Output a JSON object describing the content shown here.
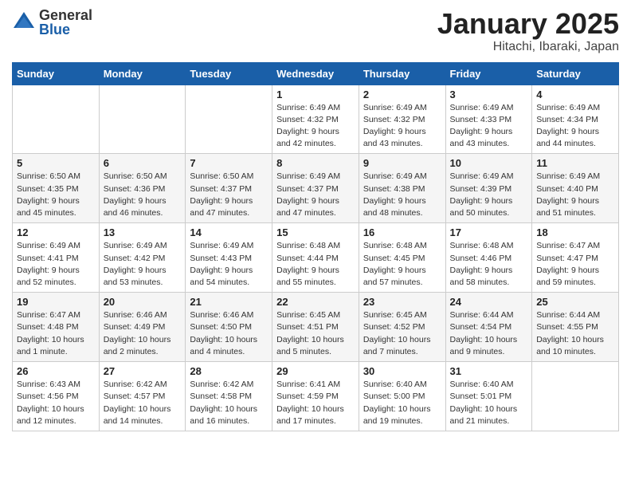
{
  "logo": {
    "general": "General",
    "blue": "Blue"
  },
  "title": "January 2025",
  "subtitle": "Hitachi, Ibaraki, Japan",
  "weekdays": [
    "Sunday",
    "Monday",
    "Tuesday",
    "Wednesday",
    "Thursday",
    "Friday",
    "Saturday"
  ],
  "weeks": [
    [
      {
        "day": "",
        "info": ""
      },
      {
        "day": "",
        "info": ""
      },
      {
        "day": "",
        "info": ""
      },
      {
        "day": "1",
        "info": "Sunrise: 6:49 AM\nSunset: 4:32 PM\nDaylight: 9 hours and 42 minutes."
      },
      {
        "day": "2",
        "info": "Sunrise: 6:49 AM\nSunset: 4:32 PM\nDaylight: 9 hours and 43 minutes."
      },
      {
        "day": "3",
        "info": "Sunrise: 6:49 AM\nSunset: 4:33 PM\nDaylight: 9 hours and 43 minutes."
      },
      {
        "day": "4",
        "info": "Sunrise: 6:49 AM\nSunset: 4:34 PM\nDaylight: 9 hours and 44 minutes."
      }
    ],
    [
      {
        "day": "5",
        "info": "Sunrise: 6:50 AM\nSunset: 4:35 PM\nDaylight: 9 hours and 45 minutes."
      },
      {
        "day": "6",
        "info": "Sunrise: 6:50 AM\nSunset: 4:36 PM\nDaylight: 9 hours and 46 minutes."
      },
      {
        "day": "7",
        "info": "Sunrise: 6:50 AM\nSunset: 4:37 PM\nDaylight: 9 hours and 47 minutes."
      },
      {
        "day": "8",
        "info": "Sunrise: 6:49 AM\nSunset: 4:37 PM\nDaylight: 9 hours and 47 minutes."
      },
      {
        "day": "9",
        "info": "Sunrise: 6:49 AM\nSunset: 4:38 PM\nDaylight: 9 hours and 48 minutes."
      },
      {
        "day": "10",
        "info": "Sunrise: 6:49 AM\nSunset: 4:39 PM\nDaylight: 9 hours and 50 minutes."
      },
      {
        "day": "11",
        "info": "Sunrise: 6:49 AM\nSunset: 4:40 PM\nDaylight: 9 hours and 51 minutes."
      }
    ],
    [
      {
        "day": "12",
        "info": "Sunrise: 6:49 AM\nSunset: 4:41 PM\nDaylight: 9 hours and 52 minutes."
      },
      {
        "day": "13",
        "info": "Sunrise: 6:49 AM\nSunset: 4:42 PM\nDaylight: 9 hours and 53 minutes."
      },
      {
        "day": "14",
        "info": "Sunrise: 6:49 AM\nSunset: 4:43 PM\nDaylight: 9 hours and 54 minutes."
      },
      {
        "day": "15",
        "info": "Sunrise: 6:48 AM\nSunset: 4:44 PM\nDaylight: 9 hours and 55 minutes."
      },
      {
        "day": "16",
        "info": "Sunrise: 6:48 AM\nSunset: 4:45 PM\nDaylight: 9 hours and 57 minutes."
      },
      {
        "day": "17",
        "info": "Sunrise: 6:48 AM\nSunset: 4:46 PM\nDaylight: 9 hours and 58 minutes."
      },
      {
        "day": "18",
        "info": "Sunrise: 6:47 AM\nSunset: 4:47 PM\nDaylight: 9 hours and 59 minutes."
      }
    ],
    [
      {
        "day": "19",
        "info": "Sunrise: 6:47 AM\nSunset: 4:48 PM\nDaylight: 10 hours and 1 minute."
      },
      {
        "day": "20",
        "info": "Sunrise: 6:46 AM\nSunset: 4:49 PM\nDaylight: 10 hours and 2 minutes."
      },
      {
        "day": "21",
        "info": "Sunrise: 6:46 AM\nSunset: 4:50 PM\nDaylight: 10 hours and 4 minutes."
      },
      {
        "day": "22",
        "info": "Sunrise: 6:45 AM\nSunset: 4:51 PM\nDaylight: 10 hours and 5 minutes."
      },
      {
        "day": "23",
        "info": "Sunrise: 6:45 AM\nSunset: 4:52 PM\nDaylight: 10 hours and 7 minutes."
      },
      {
        "day": "24",
        "info": "Sunrise: 6:44 AM\nSunset: 4:54 PM\nDaylight: 10 hours and 9 minutes."
      },
      {
        "day": "25",
        "info": "Sunrise: 6:44 AM\nSunset: 4:55 PM\nDaylight: 10 hours and 10 minutes."
      }
    ],
    [
      {
        "day": "26",
        "info": "Sunrise: 6:43 AM\nSunset: 4:56 PM\nDaylight: 10 hours and 12 minutes."
      },
      {
        "day": "27",
        "info": "Sunrise: 6:42 AM\nSunset: 4:57 PM\nDaylight: 10 hours and 14 minutes."
      },
      {
        "day": "28",
        "info": "Sunrise: 6:42 AM\nSunset: 4:58 PM\nDaylight: 10 hours and 16 minutes."
      },
      {
        "day": "29",
        "info": "Sunrise: 6:41 AM\nSunset: 4:59 PM\nDaylight: 10 hours and 17 minutes."
      },
      {
        "day": "30",
        "info": "Sunrise: 6:40 AM\nSunset: 5:00 PM\nDaylight: 10 hours and 19 minutes."
      },
      {
        "day": "31",
        "info": "Sunrise: 6:40 AM\nSunset: 5:01 PM\nDaylight: 10 hours and 21 minutes."
      },
      {
        "day": "",
        "info": ""
      }
    ]
  ]
}
